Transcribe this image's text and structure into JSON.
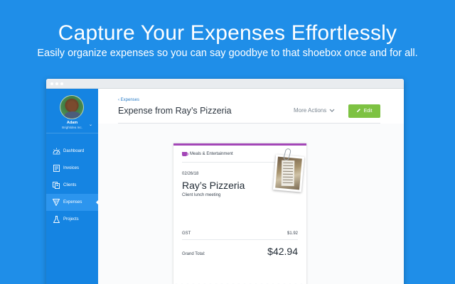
{
  "hero": {
    "title": "Capture Your Expenses Effortlessly",
    "subtitle": "Easily organize expenses so you can say goodbye to that shoebox once and for all."
  },
  "user": {
    "name": "Adam",
    "company": "Brightidea Inc."
  },
  "sidebar": {
    "items": [
      {
        "label": "Dashboard",
        "icon": "dashboard-icon",
        "active": false
      },
      {
        "label": "Invoices",
        "icon": "invoices-icon",
        "active": false
      },
      {
        "label": "Clients",
        "icon": "clients-icon",
        "active": false
      },
      {
        "label": "Expenses",
        "icon": "expenses-icon",
        "active": true
      },
      {
        "label": "Projects",
        "icon": "projects-icon",
        "active": false
      }
    ]
  },
  "header": {
    "breadcrumb": "‹ Expenses",
    "title": "Expense from Ray’s Pizzeria",
    "more_actions": "More Actions",
    "edit_label": "Edit"
  },
  "receipt": {
    "category": "Meals & Entertainment",
    "date": "02/26/18",
    "vendor": "Ray’s Pizzeria",
    "description": "Client lunch meeting",
    "tax_label": "GST",
    "tax_value": "$1.92",
    "total_label": "Grand Total:",
    "total_value": "$42.94"
  },
  "colors": {
    "background": "#1f8ee8",
    "sidebar": "#1584e2",
    "category_accent": "#a346b7",
    "edit_button": "#7dc242"
  }
}
